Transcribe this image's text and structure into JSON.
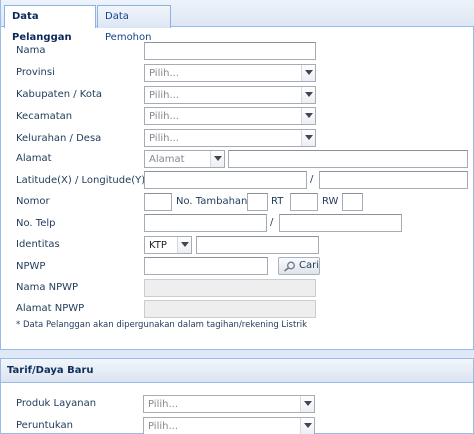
{
  "tabs": [
    {
      "label": "Data Pelanggan",
      "active": true
    },
    {
      "label": "Data Pemohon",
      "active": false
    }
  ],
  "form": {
    "nama": {
      "label": "Nama",
      "value": ""
    },
    "provinsi": {
      "label": "Provinsi",
      "value": "Pilih..."
    },
    "kabupaten": {
      "label": "Kabupaten / Kota",
      "value": "Pilih..."
    },
    "kecamatan": {
      "label": "Kecamatan",
      "value": "Pilih..."
    },
    "kelurahan": {
      "label": "Kelurahan / Desa",
      "value": "Pilih..."
    },
    "alamat": {
      "label": "Alamat",
      "type_value": "Alamat",
      "value": ""
    },
    "latlong": {
      "label": "Latitude(X) / Longitude(Y)",
      "separator": "/"
    },
    "nomor": {
      "label": "Nomor",
      "tambahan_label": "No. Tambahan",
      "rt_label": "RT",
      "rw_label": "RW"
    },
    "telp": {
      "label": "No. Telp",
      "separator": "/"
    },
    "identitas": {
      "label": "Identitas",
      "type_value": "KTP",
      "value": ""
    },
    "npwp": {
      "label": "NPWP",
      "button_label": "Cari"
    },
    "nama_npwp": {
      "label": "Nama NPWP"
    },
    "alamat_npwp": {
      "label": "Alamat NPWP"
    },
    "note": "* Data Pelanggan akan dipergunakan dalam tagihan/rekening Listrik"
  },
  "tarif": {
    "title": "Tarif/Daya Baru",
    "produk": {
      "label": "Produk Layanan",
      "value": "Pilih..."
    },
    "peruntukan": {
      "label": "Peruntukan",
      "value": "Pilih..."
    }
  },
  "icons": {
    "dropdown": "chevron-down-icon",
    "search": "magnifier-icon"
  }
}
